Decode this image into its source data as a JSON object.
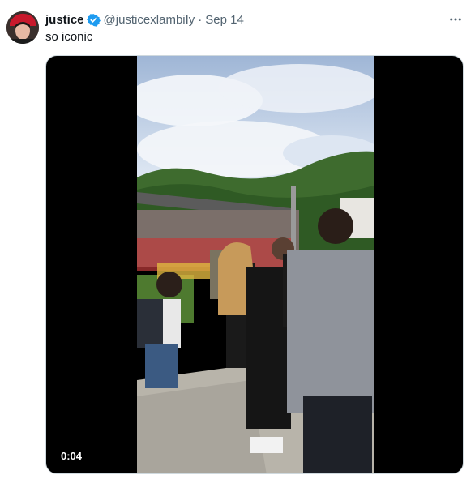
{
  "tweet": {
    "display_name": "justice",
    "handle": "@justicexlambiIy",
    "separator": "·",
    "date": "Sep 14",
    "text": "so iconic",
    "verified_color": "#1d9bf0",
    "more_icon": "ellipsis-icon"
  },
  "video": {
    "timestamp": "0:04"
  }
}
